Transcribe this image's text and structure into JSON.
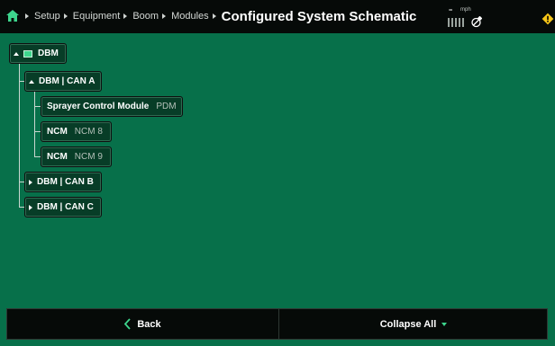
{
  "header": {
    "breadcrumbs": [
      "Setup",
      "Equipment",
      "Boom",
      "Modules"
    ],
    "title": "Configured System Schematic",
    "speed_value": "--",
    "speed_unit": "mph"
  },
  "tree": {
    "root": {
      "label": "DBM"
    },
    "can_a": {
      "label": "DBM | CAN A"
    },
    "children": [
      {
        "name": "Sprayer Control Module",
        "detail": "PDM"
      },
      {
        "name": "NCM",
        "detail": "NCM 8"
      },
      {
        "name": "NCM",
        "detail": "NCM 9"
      }
    ],
    "can_b": {
      "label": "DBM | CAN B"
    },
    "can_c": {
      "label": "DBM | CAN C"
    }
  },
  "footer": {
    "back_label": "Back",
    "collapse_label": "Collapse All"
  },
  "colors": {
    "background": "#07704a",
    "node": "#073d27",
    "accent": "#3dd58d",
    "warning": "#f5c518"
  }
}
